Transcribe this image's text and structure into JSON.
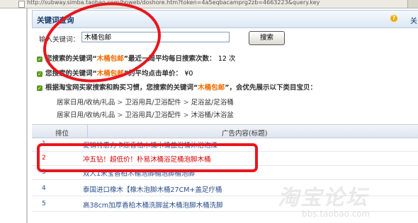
{
  "browser": {
    "url": "http://subway.simba.taobao.com/bpweb/doshore.htm?token=4a5eqbacamprg2zb=4663223&query.key"
  },
  "panel": {
    "title": "关键词查询",
    "help_label": "关"
  },
  "search": {
    "label": "输入关键词：",
    "value": "木桶包邮",
    "button_label": "搜索"
  },
  "info": [
    {
      "prefix": "您搜索的关键词“",
      "keyword": "木桶包邮",
      "suffix": "”最近一周平均每日搜索次数：",
      "value": "12 次"
    },
    {
      "prefix": "您搜索的关键词“",
      "keyword": "木桶包邮",
      "suffix": "”的平均点击单价：",
      "value": "¥0"
    },
    {
      "prefix": "根据淘宝网买家搜索和购买习惯，您搜索的关键词“",
      "keyword": "木桶包邮",
      "suffix": "”，会优先展示以下类目宝贝：",
      "value": ""
    }
  ],
  "categories": [
    [
      "居家日用/收纳/礼品",
      "卫浴用具/卫浴配件",
      "足浴盆/足浴桶"
    ],
    [
      "居家日用/收纳/礼品",
      "卫浴用具/卫浴配件",
      "沐浴桶/沐浴盆"
    ]
  ],
  "table": {
    "col_rank": "排位",
    "col_ad": "广告内容(标题)",
    "rows": [
      {
        "rank": "1",
        "ad": "促销特惠力卡原香柏木桶木桶盖浴桶沐浴泡澡"
      },
      {
        "rank": "2",
        "ad": "冲五钻！超低价！朴易沐桶浴足桶泡脚木桶"
      },
      {
        "rank": "3",
        "ad": "双人1米宝香柏木桶泡脚桶泡脚桶泡脚"
      },
      {
        "rank": "4",
        "ad": "泰国进口橡木【橡木泡脚木桶27CM+盖足疗桶"
      },
      {
        "rank": "5",
        "ad": "高38cm加厚香柏木桶洗脚盆木桶泡脚木桶洗脚"
      }
    ]
  },
  "watermark": {
    "text": "淘宝论坛",
    "url": "bbs.taobao.com"
  },
  "colors": {
    "keyword": "#f06a00",
    "annotation": "#e8161e",
    "highlight_row_text": "#d90000",
    "link": "#2a4e8c"
  }
}
